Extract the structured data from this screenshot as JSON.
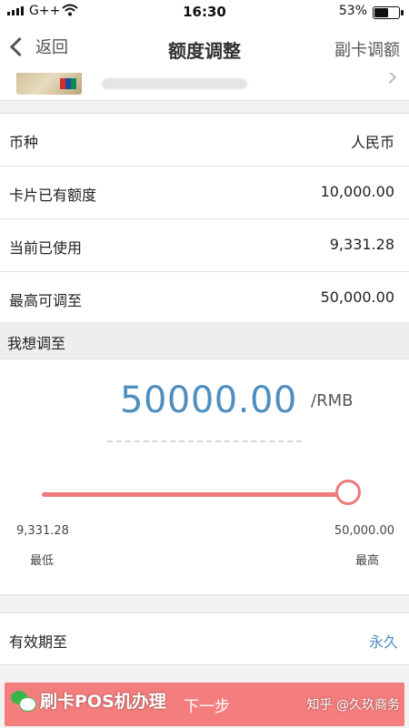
{
  "status_bar": {
    "carrier": "G++",
    "time": "16:30",
    "battery": "53%",
    "battery_level": 0.53
  },
  "nav": {
    "back_label": "返回",
    "title": "额度调整",
    "right_label": "副卡调额"
  },
  "info_rows": [
    {
      "label": "币种",
      "value": "人民币"
    },
    {
      "label": "卡片已有额度",
      "value": "10,000.00"
    },
    {
      "label": "当前已使用",
      "value": "9,331.28"
    },
    {
      "label": "最高可调至",
      "value": "50,000.00"
    }
  ],
  "adjust": {
    "section_title": "我想调至",
    "amount": "50000.00",
    "unit": "/RMB",
    "slider_level": 1.0,
    "min_value": "9,331.28",
    "max_value": "50,000.00",
    "min_label": "最低",
    "max_label": "最高"
  },
  "validity": {
    "label": "有效期至",
    "value": "永久"
  },
  "next_button": {
    "label": "下一步"
  },
  "watermark": {
    "text": "刷卡POS机办理",
    "source": "知乎 @久玖商务"
  },
  "colors": {
    "accent_blue": "#4f8fc0",
    "slider_red": "#ee7a7a",
    "button_red": "#f47d7d"
  }
}
